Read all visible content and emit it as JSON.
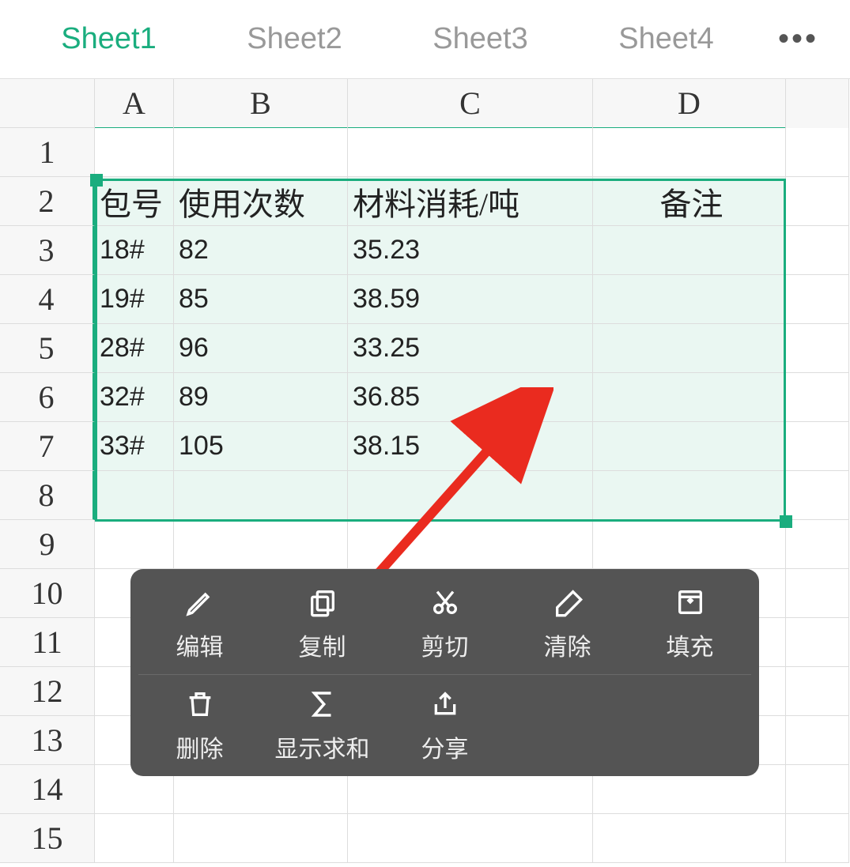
{
  "tabs": [
    "Sheet1",
    "Sheet2",
    "Sheet3",
    "Sheet4"
  ],
  "active_tab": 0,
  "columns": [
    "A",
    "B",
    "C",
    "D"
  ],
  "row_count": 15,
  "table": {
    "headers": [
      "包号",
      "使用次数",
      "材料消耗/吨",
      "备注"
    ],
    "rows": [
      [
        "18#",
        "82",
        "35.23",
        ""
      ],
      [
        "19#",
        "85",
        "38.59",
        ""
      ],
      [
        "28#",
        "96",
        "33.25",
        ""
      ],
      [
        "32#",
        "89",
        "36.85",
        ""
      ],
      [
        "33#",
        "105",
        "38.15",
        ""
      ]
    ]
  },
  "menu": {
    "edit": "编辑",
    "copy": "复制",
    "cut": "剪切",
    "clear": "清除",
    "fill": "填充",
    "delete": "删除",
    "sum": "显示求和",
    "share": "分享"
  },
  "chart_data": {
    "type": "table",
    "columns": [
      "包号",
      "使用次数",
      "材料消耗/吨",
      "备注"
    ],
    "rows": [
      {
        "包号": "18#",
        "使用次数": 82,
        "材料消耗/吨": 35.23,
        "备注": ""
      },
      {
        "包号": "19#",
        "使用次数": 85,
        "材料消耗/吨": 38.59,
        "备注": ""
      },
      {
        "包号": "28#",
        "使用次数": 96,
        "材料消耗/吨": 33.25,
        "备注": ""
      },
      {
        "包号": "32#",
        "使用次数": 89,
        "材料消耗/吨": 36.85,
        "备注": ""
      },
      {
        "包号": "33#",
        "使用次数": 105,
        "材料消耗/吨": 38.15,
        "备注": ""
      }
    ]
  }
}
